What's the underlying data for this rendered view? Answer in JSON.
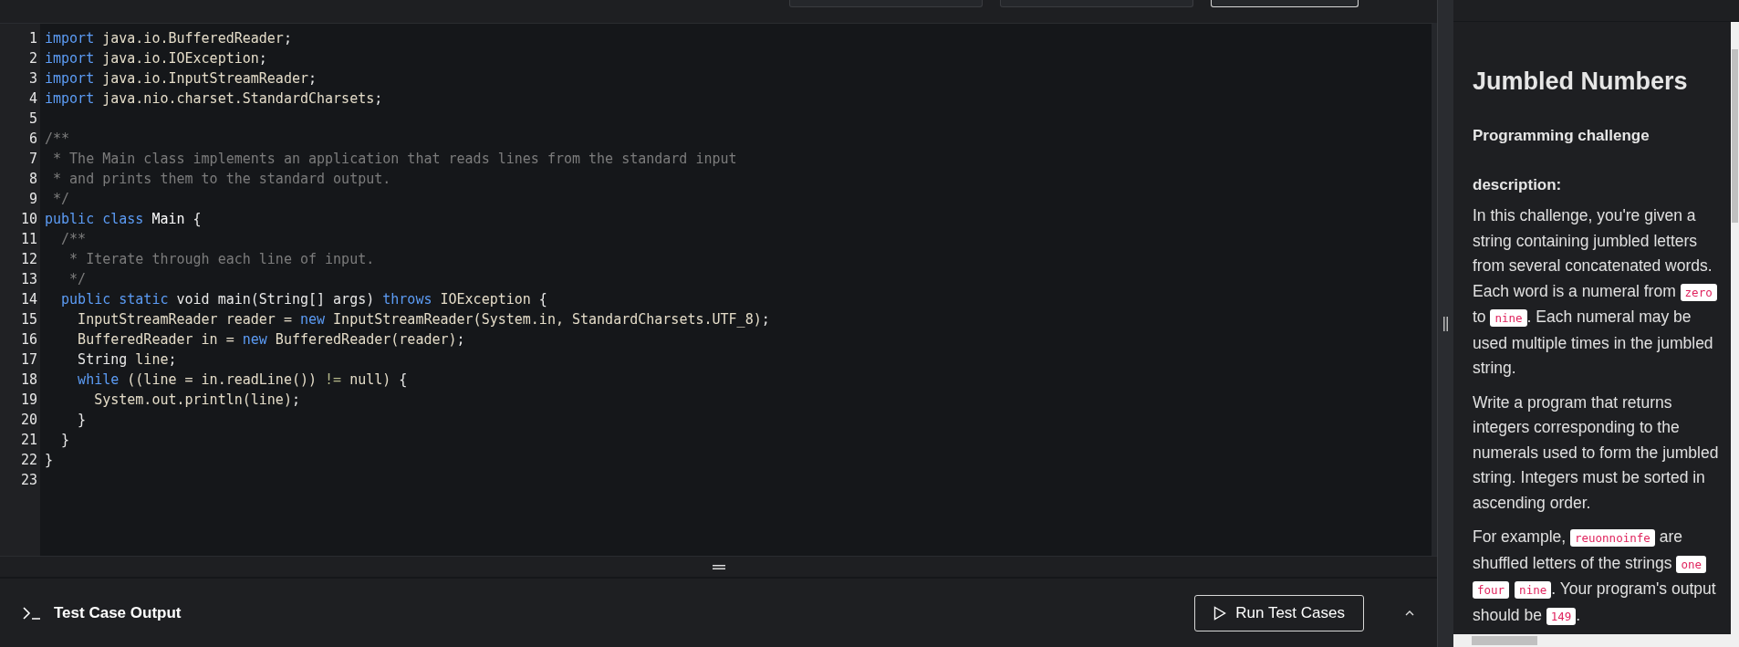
{
  "toolbar": {
    "buttons": [
      {
        "kind": "plain"
      },
      {
        "kind": "plain"
      },
      {
        "kind": "outlined"
      }
    ]
  },
  "editor": {
    "lines": [
      {
        "number": "1",
        "tokens": [
          {
            "kind": "kw",
            "text": "import"
          },
          {
            "kind": "type",
            "text": " java.io.BufferedReader"
          },
          {
            "kind": "plain",
            "text": ";"
          }
        ]
      },
      {
        "number": "2",
        "tokens": [
          {
            "kind": "kw",
            "text": "import"
          },
          {
            "kind": "type",
            "text": " java.io.IOException"
          },
          {
            "kind": "plain",
            "text": ";"
          }
        ]
      },
      {
        "number": "3",
        "tokens": [
          {
            "kind": "kw",
            "text": "import"
          },
          {
            "kind": "type",
            "text": " java.io.InputStreamReader"
          },
          {
            "kind": "plain",
            "text": ";"
          }
        ]
      },
      {
        "number": "4",
        "tokens": [
          {
            "kind": "kw",
            "text": "import"
          },
          {
            "kind": "type",
            "text": " java.nio.charset.StandardCharsets"
          },
          {
            "kind": "plain",
            "text": ";"
          }
        ]
      },
      {
        "number": "5"
      },
      {
        "number": "6",
        "tokens": [
          {
            "kind": "comment",
            "text": "/**"
          }
        ]
      },
      {
        "number": "7",
        "tokens": [
          {
            "kind": "comment",
            "text": " * The Main class implements an application that reads lines from the standard input"
          }
        ]
      },
      {
        "number": "8",
        "tokens": [
          {
            "kind": "comment",
            "text": " * and prints them to the standard output."
          }
        ]
      },
      {
        "number": "9",
        "tokens": [
          {
            "kind": "comment",
            "text": " */"
          }
        ]
      },
      {
        "number": "10",
        "tokens": [
          {
            "kind": "kw",
            "text": "public class"
          },
          {
            "kind": "name",
            "text": " Main"
          },
          {
            "kind": "plain",
            "text": " {"
          }
        ]
      },
      {
        "number": "11",
        "tokens": [
          {
            "kind": "comment",
            "text": "  /**"
          }
        ]
      },
      {
        "number": "12",
        "tokens": [
          {
            "kind": "comment",
            "text": "   * Iterate through each line of input."
          }
        ]
      },
      {
        "number": "13",
        "tokens": [
          {
            "kind": "comment",
            "text": "   */"
          }
        ]
      },
      {
        "number": "14",
        "tokens": [
          {
            "kind": "kw",
            "text": "  public static"
          },
          {
            "kind": "plain",
            "text": " void main(String[] args) "
          },
          {
            "kind": "kw",
            "text": "throws"
          },
          {
            "kind": "type",
            "text": " IOException"
          },
          {
            "kind": "plain",
            "text": " {"
          }
        ]
      },
      {
        "number": "15",
        "tokens": [
          {
            "kind": "type",
            "text": "    InputStreamReader reader = "
          },
          {
            "kind": "kw",
            "text": "new"
          },
          {
            "kind": "type",
            "text": " InputStreamReader(System.in, StandardCharsets.UTF_8)"
          },
          {
            "kind": "plain",
            "text": ";"
          }
        ]
      },
      {
        "number": "16",
        "tokens": [
          {
            "kind": "type",
            "text": "    BufferedReader in = "
          },
          {
            "kind": "kw",
            "text": "new"
          },
          {
            "kind": "type",
            "text": " BufferedReader(reader)"
          },
          {
            "kind": "plain",
            "text": ";"
          }
        ]
      },
      {
        "number": "17",
        "tokens": [
          {
            "kind": "plain",
            "text": "    String"
          },
          {
            "kind": "type",
            "text": " line"
          },
          {
            "kind": "plain",
            "text": ";"
          }
        ]
      },
      {
        "number": "18",
        "tokens": [
          {
            "kind": "kw",
            "text": "    while"
          },
          {
            "kind": "type",
            "text": " ((line = in.readLine()) "
          },
          {
            "kind": "op",
            "text": "!="
          },
          {
            "kind": "type",
            "text": " null) "
          },
          {
            "kind": "plain",
            "text": "{"
          }
        ]
      },
      {
        "number": "19",
        "tokens": [
          {
            "kind": "type",
            "text": "      System.out.println(line)"
          },
          {
            "kind": "plain",
            "text": ";"
          }
        ]
      },
      {
        "number": "20",
        "tokens": [
          {
            "kind": "plain",
            "text": "    }"
          }
        ]
      },
      {
        "number": "21",
        "tokens": [
          {
            "kind": "plain",
            "text": "  }"
          }
        ]
      },
      {
        "number": "22",
        "tokens": [
          {
            "kind": "plain",
            "text": "}"
          }
        ]
      },
      {
        "number": "23"
      }
    ]
  },
  "output_panel": {
    "title": "Test Case Output",
    "run_button": "Run Test Cases"
  },
  "description": {
    "title": "Jumbled Numbers",
    "subtitle": "Programming challenge",
    "label": "description:",
    "paragraphs": [
      [
        {
          "kind": "text",
          "text": "In this challenge, you're given a string containing jumbled letters from several concatenated words. Each word is a numeral from "
        },
        {
          "kind": "code",
          "text": "zero"
        },
        {
          "kind": "text",
          "text": " to "
        },
        {
          "kind": "code",
          "text": "nine"
        },
        {
          "kind": "text",
          "text": ". Each numeral may be used multiple times in the jumbled string."
        }
      ],
      [
        {
          "kind": "text",
          "text": "Write a program that returns integers corresponding to the numerals used to form the jumbled string. Integers must be sorted in ascending order."
        }
      ],
      [
        {
          "kind": "text",
          "text": "For example, "
        },
        {
          "kind": "code",
          "text": "reuonnoinfe"
        },
        {
          "kind": "text",
          "text": " are shuffled letters of the strings "
        },
        {
          "kind": "code",
          "text": "one"
        },
        {
          "kind": "gap"
        },
        {
          "kind": "code",
          "text": "four"
        },
        {
          "kind": "gap"
        },
        {
          "kind": "code",
          "text": "nine"
        },
        {
          "kind": "text",
          "text": ". Your program's output should be "
        },
        {
          "kind": "code",
          "text": "149"
        },
        {
          "kind": "text",
          "text": "."
        }
      ]
    ]
  }
}
